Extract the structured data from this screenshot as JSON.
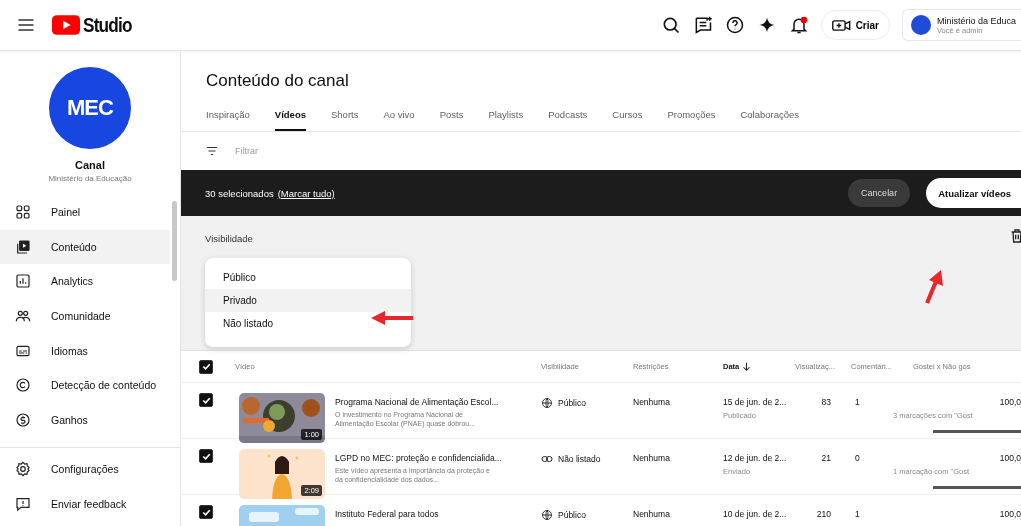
{
  "header": {
    "logo_text": "Studio",
    "create_label": "Criar",
    "account": {
      "name": "Ministério da Educa",
      "role": "Você é admin"
    },
    "notifications_unread": true
  },
  "sidebar": {
    "logo_text": "MEC",
    "channel_label": "Canal",
    "channel_name": "Ministério da Educação",
    "items": [
      {
        "label": "Painel",
        "kind": "dashboard",
        "selected": false
      },
      {
        "label": "Conteúdo",
        "kind": "content",
        "selected": true
      },
      {
        "label": "Analytics",
        "kind": "analytics",
        "selected": false
      },
      {
        "label": "Comunidade",
        "kind": "community",
        "selected": false
      },
      {
        "label": "Idiomas",
        "kind": "languages",
        "selected": false
      },
      {
        "label": "Detecção de conteúdo",
        "kind": "copyright",
        "selected": false
      },
      {
        "label": "Ganhos",
        "kind": "earnings",
        "selected": false
      }
    ],
    "footer_items": [
      {
        "label": "Configurações",
        "kind": "settings"
      },
      {
        "label": "Enviar feedback",
        "kind": "feedback"
      }
    ]
  },
  "page": {
    "title": "Conteúdo do canal",
    "tabs": [
      {
        "label": "Inspiração",
        "selected": false
      },
      {
        "label": "Vídeos",
        "selected": true
      },
      {
        "label": "Shorts",
        "selected": false
      },
      {
        "label": "Ao vivo",
        "selected": false
      },
      {
        "label": "Posts",
        "selected": false
      },
      {
        "label": "Playlists",
        "selected": false
      },
      {
        "label": "Podcasts",
        "selected": false
      },
      {
        "label": "Cursos",
        "selected": false
      },
      {
        "label": "Promoções",
        "selected": false
      },
      {
        "label": "Colaborações",
        "selected": false
      }
    ],
    "filter": {
      "placeholder": "Filtrar"
    },
    "selection_bar": {
      "count": "30 selecionados",
      "link": "(Marcar tudo)",
      "cancel": "Cancelar",
      "update": "Atualizar vídeos"
    },
    "edit_panel": {
      "label": "Visibilidade",
      "options": [
        {
          "label": "Público",
          "hovered": false
        },
        {
          "label": "Privado",
          "hovered": true
        },
        {
          "label": "Não listado",
          "hovered": false
        }
      ]
    },
    "table": {
      "select_all": true,
      "columns": [
        {
          "label": "Vídeo",
          "sorted": false
        },
        {
          "label": "Visibilidade",
          "sorted": false
        },
        {
          "label": "Restrições",
          "sorted": false
        },
        {
          "label": "Data",
          "sorted": true
        },
        {
          "label": "Visualizaç...",
          "sorted": false
        },
        {
          "label": "Comentári...",
          "sorted": false
        },
        {
          "label": "Gostei x Não gos",
          "sorted": false
        }
      ],
      "rows": [
        {
          "checked": true,
          "duration": "1:00",
          "title": "Programa Nacional de Alimentação Escol...",
          "description": "O investimento no Programa Nacional de Alimentação Escolar (PNAE) quase dobrou...",
          "visibility": "Público",
          "kind": "public",
          "restrictions": "Nenhuma",
          "date": "15 de jun. de 2...",
          "date_status": "Publicado",
          "views": "83",
          "comments": "1",
          "likes": "100,0",
          "likes_note": "3 marcações com \"Gost",
          "level": 1
        },
        {
          "checked": true,
          "duration": "2:09",
          "title": "LGPD no MEC: proteção e confidencialida...",
          "description": "Este vídeo apresenta a importância da proteção e da confidencialidade dos dados...",
          "visibility": "Não listado",
          "kind": "unlisted",
          "restrictions": "Nenhuma",
          "date": "12 de jun. de 2...",
          "date_status": "Enviado",
          "views": "21",
          "comments": "0",
          "likes": "100,0",
          "likes_note": "1 marcação com \"Gost",
          "level": 1
        },
        {
          "checked": true,
          "title": "Instituto Federal para todos",
          "visibility": "Público",
          "kind": "public",
          "restrictions": "Nenhuma",
          "date": "10 de jun. de 2...",
          "views": "210",
          "comments": "1",
          "likes": "100,0"
        }
      ]
    }
  }
}
